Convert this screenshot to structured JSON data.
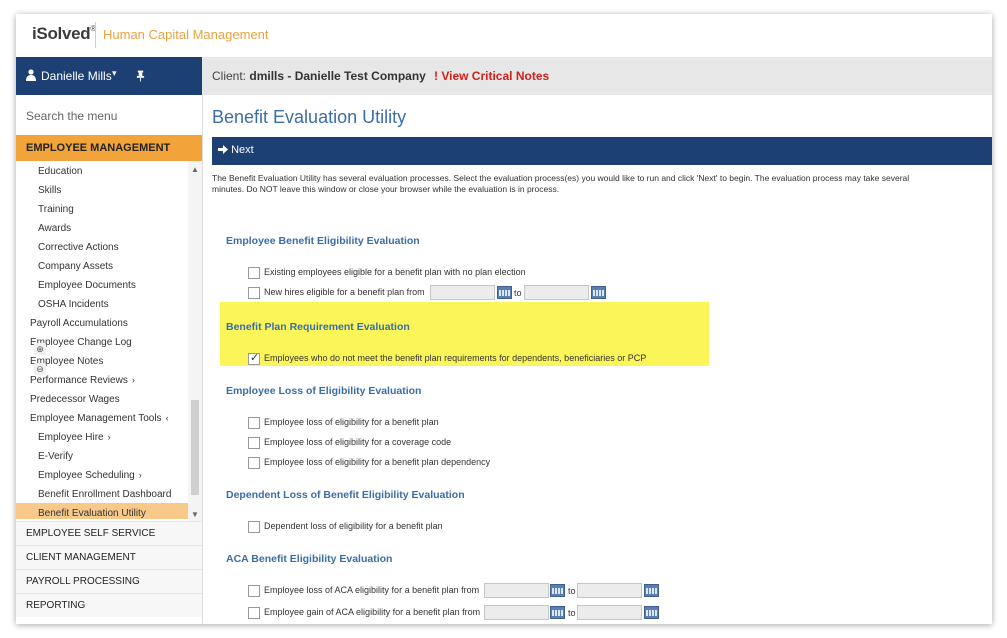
{
  "header": {
    "logo_text": "iSolved",
    "logo_mark": "®",
    "app_title": "Human Capital Management"
  },
  "user": {
    "name": "Danielle Mills",
    "caret": "▾",
    "pin": "📌"
  },
  "client": {
    "prefix": "Client:",
    "value": "dmills - Danielle Test Company",
    "critical_icon": "!",
    "critical_label": "View Critical Notes"
  },
  "sidebar": {
    "search_placeholder": "Search the menu",
    "section_title": "EMPLOYEE MANAGEMENT",
    "items": [
      {
        "label": "Education",
        "chev": ""
      },
      {
        "label": "Skills",
        "chev": ""
      },
      {
        "label": "Training",
        "chev": ""
      },
      {
        "label": "Awards",
        "chev": ""
      },
      {
        "label": "Corrective Actions",
        "chev": ""
      },
      {
        "label": "Company Assets",
        "chev": ""
      },
      {
        "label": "Employee Documents",
        "chev": ""
      },
      {
        "label": "OSHA Incidents",
        "chev": ""
      },
      {
        "label": "Payroll Accumulations",
        "chev": ""
      },
      {
        "label": "Employee Change Log",
        "chev": ""
      },
      {
        "label": "Employee Notes",
        "chev": ""
      },
      {
        "label": "Performance Reviews",
        "chev": "›"
      },
      {
        "label": "Predecessor Wages",
        "chev": ""
      },
      {
        "label": "Employee Management Tools",
        "chev": "‹"
      },
      {
        "label": "Employee Hire",
        "chev": "›"
      },
      {
        "label": "E-Verify",
        "chev": ""
      },
      {
        "label": "Employee Scheduling",
        "chev": "›"
      },
      {
        "label": "Benefit Enrollment Dashboard",
        "chev": ""
      },
      {
        "label": "Benefit Evaluation Utility",
        "chev": ""
      }
    ],
    "bottom": [
      "EMPLOYEE SELF SERVICE",
      "CLIENT MANAGEMENT",
      "PAYROLL PROCESSING",
      "REPORTING"
    ]
  },
  "main": {
    "title": "Benefit Evaluation Utility",
    "next_label": "Next",
    "intro": "The Benefit Evaluation Utility has several evaluation processes. Select the evaluation process(es) you would like to run and click 'Next' to begin. The evaluation process may take several minutes. Do NOT leave this window or close your browser while the evaluation is in process.",
    "sections": {
      "s1": {
        "title": "Employee Benefit Eligibility Evaluation",
        "opt1": "Existing employees eligible for a benefit plan with no plan election",
        "opt2": "New hires eligible for a benefit plan from",
        "to": "to"
      },
      "s2": {
        "title": "Benefit Plan Requirement Evaluation",
        "opt1": "Employees who do not meet the benefit plan requirements for dependents, beneficiaries or PCP",
        "opt1_checked": true
      },
      "s3": {
        "title": "Employee Loss of Eligibility Evaluation",
        "opt1": "Employee loss of eligibility for a benefit plan",
        "opt2": "Employee loss of eligibility for a coverage code",
        "opt3": "Employee loss of eligibility for a benefit plan dependency"
      },
      "s4": {
        "title": "Dependent Loss of Benefit Eligibility Evaluation",
        "opt1": "Dependent loss of eligibility for a benefit plan"
      },
      "s5": {
        "title": "ACA Benefit Eligibility Evaluation",
        "opt1": "Employee loss of ACA eligibility for a benefit plan from",
        "opt2": "Employee gain of ACA eligibility for a benefit plan from",
        "to": "to"
      }
    }
  },
  "colors": {
    "brand_navy": "#1c3f74",
    "accent_orange": "#f2a33a",
    "heading_blue": "#3a6ea5",
    "critical_red": "#d0211c",
    "highlight_yellow": "#fbf55a"
  }
}
